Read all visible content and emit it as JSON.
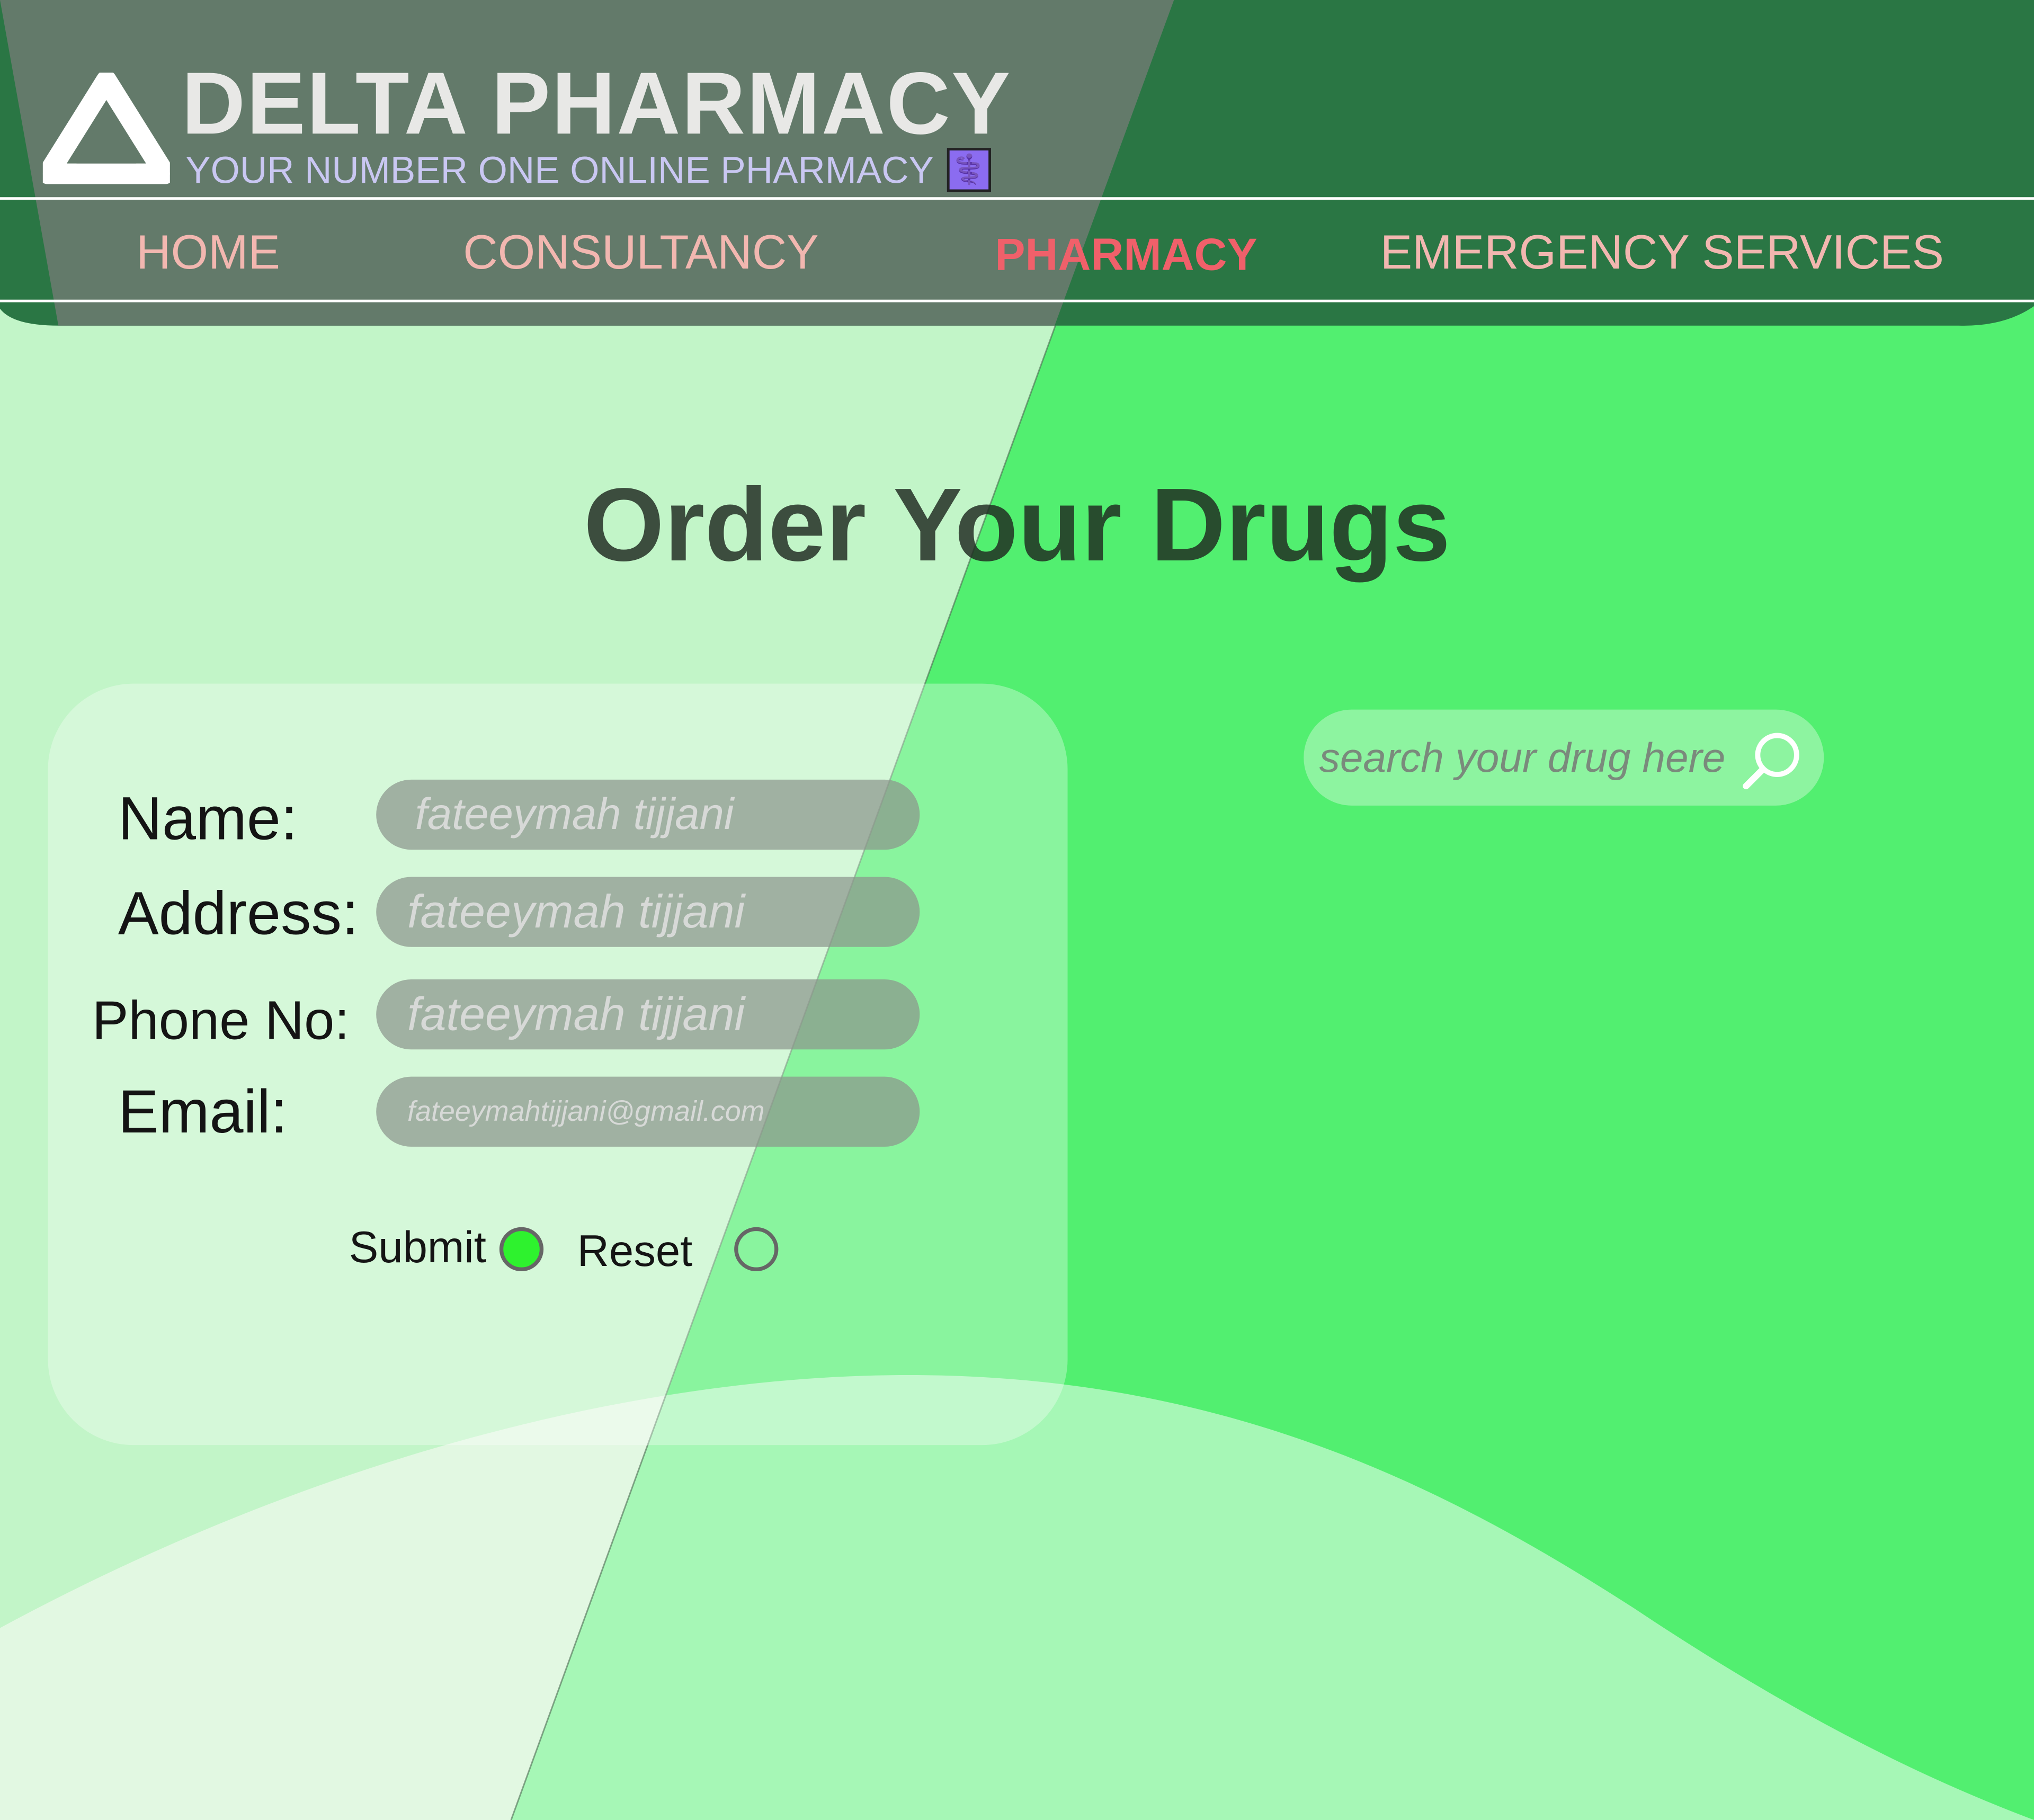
{
  "brand": {
    "title": "DELTA PHARMACY",
    "tagline": "YOUR NUMBER ONE ONLINE PHARMACY",
    "tag_icon": "⚕️",
    "logo_icon": "delta-logo"
  },
  "nav": {
    "items": [
      {
        "label": "HOME"
      },
      {
        "label": "CONSULTANCY"
      },
      {
        "label": "PHARMACY",
        "active": true
      },
      {
        "label": "EMERGENCY SERVICES"
      }
    ]
  },
  "main": {
    "title": "Order Your Drugs"
  },
  "form": {
    "name_label": "Name:",
    "address_label": "Address:",
    "phone_label": "Phone No:",
    "email_label": "Email:",
    "name_placeholder": "fateeymah tijjani",
    "address_placeholder": "fateeymah tijjani",
    "phone_placeholder": "fateeymah tijjani",
    "email_placeholder": "fateeymahtijjani@gmail.com",
    "submit_label": "Submit",
    "reset_label": "Reset",
    "submit_selected": true,
    "reset_selected": false
  },
  "search": {
    "placeholder": "search your drug here",
    "icon": "search-icon"
  },
  "colors": {
    "header_dark": "#2a7644",
    "header_overlay": "#637a6a",
    "page_green": "#52ef70",
    "page_light": "#c2f5c8",
    "active_nav": "#f0606a",
    "nav_text": "#f2b7b0",
    "tagline": "#c9c7f2",
    "radio_selected": "#2ef22e"
  }
}
